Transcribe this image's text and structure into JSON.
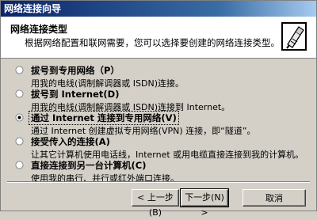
{
  "window": {
    "title": "网络连接向导"
  },
  "header": {
    "title": "网络连接类型",
    "subtitle": "根据网络配置和联网需要，您可以选择要创建的网络连接类型。",
    "icon": "network-connection-icon"
  },
  "options": [
    {
      "label": "拔号到专用网络（P）",
      "desc": "用我的电线(调制解调器或 ISDN)连接。",
      "selected": false
    },
    {
      "label": "拔号到 Internet(D)",
      "desc": "用我的电线(调制解调器或 ISDN)连接到 Internet。",
      "selected": false
    },
    {
      "label": "通过 Internet 连接到专用网络(V)",
      "desc": "通过 Internet 创建虚拟专用网络(VPN) 连接，即“隧道”。",
      "selected": true
    },
    {
      "label": "接受传入的连接(A)",
      "desc": "让其它计算机使用电话线，Internet 或用电缆直接连接到我的计算机。",
      "selected": false
    },
    {
      "label": "直接连接到另一台计算机(C)",
      "desc": "使用我的串行、并行或红外端口连接。",
      "selected": false
    }
  ],
  "buttons": {
    "back": "< 上一步(B)",
    "next": "下一步(N) >",
    "cancel": "取消"
  }
}
